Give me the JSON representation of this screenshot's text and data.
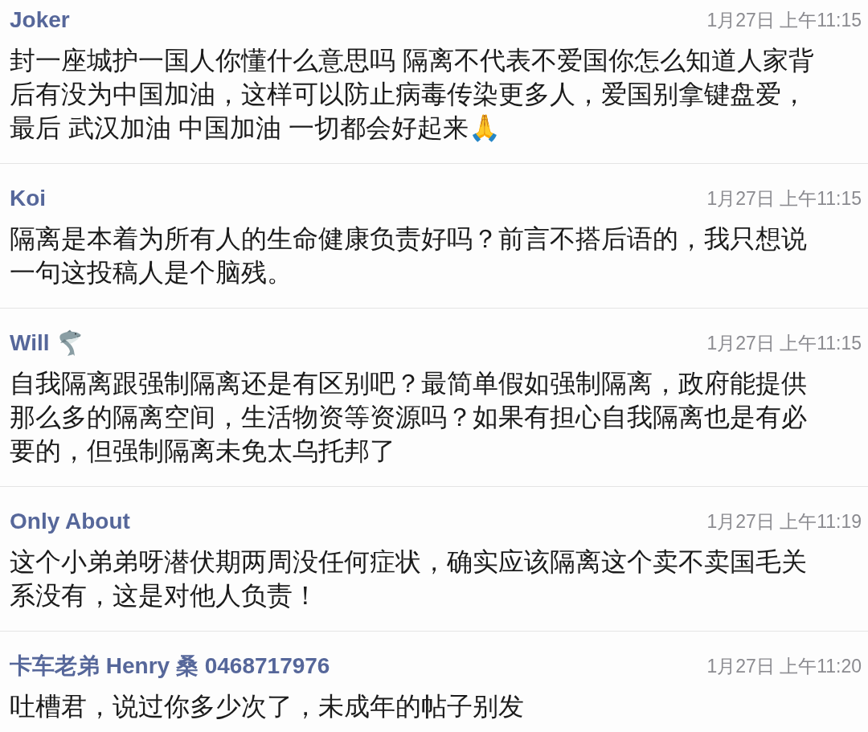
{
  "comments": [
    {
      "author": "Joker",
      "time": "1月27日 上午11:15",
      "text": "封一座城护一国人你懂什么意思吗 隔离不代表不爱国你怎么知道人家背后有没为中国加油，这样可以防止病毒传染更多人，爱国别拿键盘爱，最后 武汉加油 中国加油 一切都会好起来🙏"
    },
    {
      "author": "Koi",
      "time": "1月27日 上午11:15",
      "text": "隔离是本着为所有人的生命健康负责好吗？前言不搭后语的，我只想说一句这投稿人是个脑残。"
    },
    {
      "author": "Will",
      "author_emoji": {
        "kind": "shark"
      },
      "time": "1月27日 上午11:15",
      "text": "自我隔离跟强制隔离还是有区别吧？最简单假如强制隔离，政府能提供那么多的隔离空间，生活物资等资源吗？如果有担心自我隔离也是有必要的，但强制隔离未免太乌托邦了"
    },
    {
      "author": "Only About",
      "time": "1月27日 上午11:19",
      "text": "这个小弟弟呀潜伏期两周没任何症状，确实应该隔离这个卖不卖国毛关系没有，这是对他人负责！"
    },
    {
      "author": "卡车老弟 Henry 桑 0468717976",
      "time": "1月27日 上午11:20",
      "text": "吐槽君，说过你多少次了，未成年的帖子别发"
    }
  ]
}
